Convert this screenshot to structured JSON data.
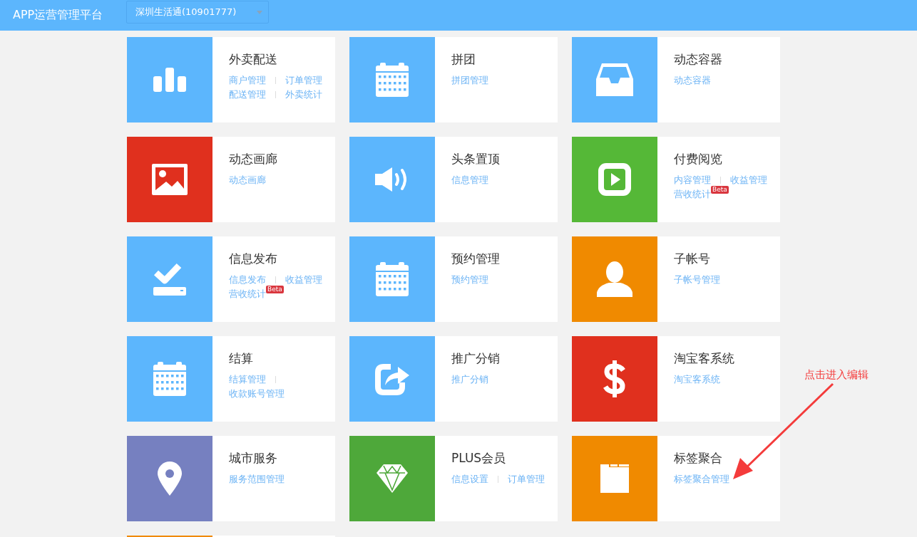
{
  "header": {
    "title": "APP运营管理平台",
    "store_select": {
      "value": "深圳生活通(10901777)"
    }
  },
  "cards": [
    {
      "kind": "bar-chart",
      "color": "#5cb6fd",
      "title": "外卖配送",
      "link_rows": [
        [
          {
            "text": "商户管理"
          },
          {
            "text": "订单管理"
          }
        ],
        [
          {
            "text": "配送管理"
          },
          {
            "text": "外卖统计"
          }
        ]
      ]
    },
    {
      "kind": "calendar",
      "color": "#5cb6fd",
      "title": "拼团",
      "link_rows": [
        [
          {
            "text": "拼团管理"
          }
        ]
      ]
    },
    {
      "kind": "tray",
      "color": "#5cb6fd",
      "title": "动态容器",
      "link_rows": [
        [
          {
            "text": "动态容器"
          }
        ]
      ]
    },
    {
      "kind": "image",
      "color": "#e0301e",
      "title": "动态画廊",
      "link_rows": [
        [
          {
            "text": "动态画廊"
          }
        ]
      ]
    },
    {
      "kind": "speaker",
      "color": "#5cb6fd",
      "title": "头条置顶",
      "link_rows": [
        [
          {
            "text": "信息管理"
          }
        ]
      ]
    },
    {
      "kind": "play",
      "color": "#55b837",
      "title": "付费阅览",
      "link_rows": [
        [
          {
            "text": "内容管理"
          },
          {
            "text": "收益管理"
          }
        ],
        [
          {
            "text": "营收统计",
            "badge": "Beta"
          }
        ]
      ]
    },
    {
      "kind": "check",
      "color": "#5cb6fd",
      "title": "信息发布",
      "link_rows": [
        [
          {
            "text": "信息发布"
          },
          {
            "text": "收益管理"
          }
        ],
        [
          {
            "text": "营收统计",
            "badge": "Beta"
          }
        ]
      ]
    },
    {
      "kind": "calendar",
      "color": "#5cb6fd",
      "title": "预约管理",
      "link_rows": [
        [
          {
            "text": "预约管理"
          }
        ]
      ]
    },
    {
      "kind": "person",
      "color": "#f08a00",
      "title": "子帐号",
      "link_rows": [
        [
          {
            "text": "子帐号管理"
          }
        ]
      ]
    },
    {
      "kind": "calendar",
      "color": "#5cb6fd",
      "title": "结算",
      "link_rows": [
        [
          {
            "text": "结算管理"
          },
          {
            "text": "收款账号管理"
          }
        ]
      ]
    },
    {
      "kind": "share",
      "color": "#5cb6fd",
      "title": "推广分销",
      "link_rows": [
        [
          {
            "text": "推广分销"
          }
        ]
      ]
    },
    {
      "kind": "dollar",
      "color": "#e0301e",
      "title": "淘宝客系统",
      "link_rows": [
        [
          {
            "text": "淘宝客系统"
          }
        ]
      ]
    },
    {
      "kind": "pin",
      "color": "#7680c0",
      "title": "城市服务",
      "link_rows": [
        [
          {
            "text": "服务范围管理"
          }
        ]
      ]
    },
    {
      "kind": "diamond",
      "color": "#4ea83a",
      "title": "PLUS会员",
      "link_rows": [
        [
          {
            "text": "信息设置"
          },
          {
            "text": "订单管理"
          }
        ]
      ]
    },
    {
      "kind": "folder",
      "color": "#f08a00",
      "title": "标签聚合",
      "link_rows": [
        [
          {
            "text": "标签聚合管理"
          }
        ]
      ]
    },
    {
      "kind": "blank",
      "color": "#f08a00"
    }
  ],
  "annotation": {
    "text": "点击进入编辑"
  }
}
